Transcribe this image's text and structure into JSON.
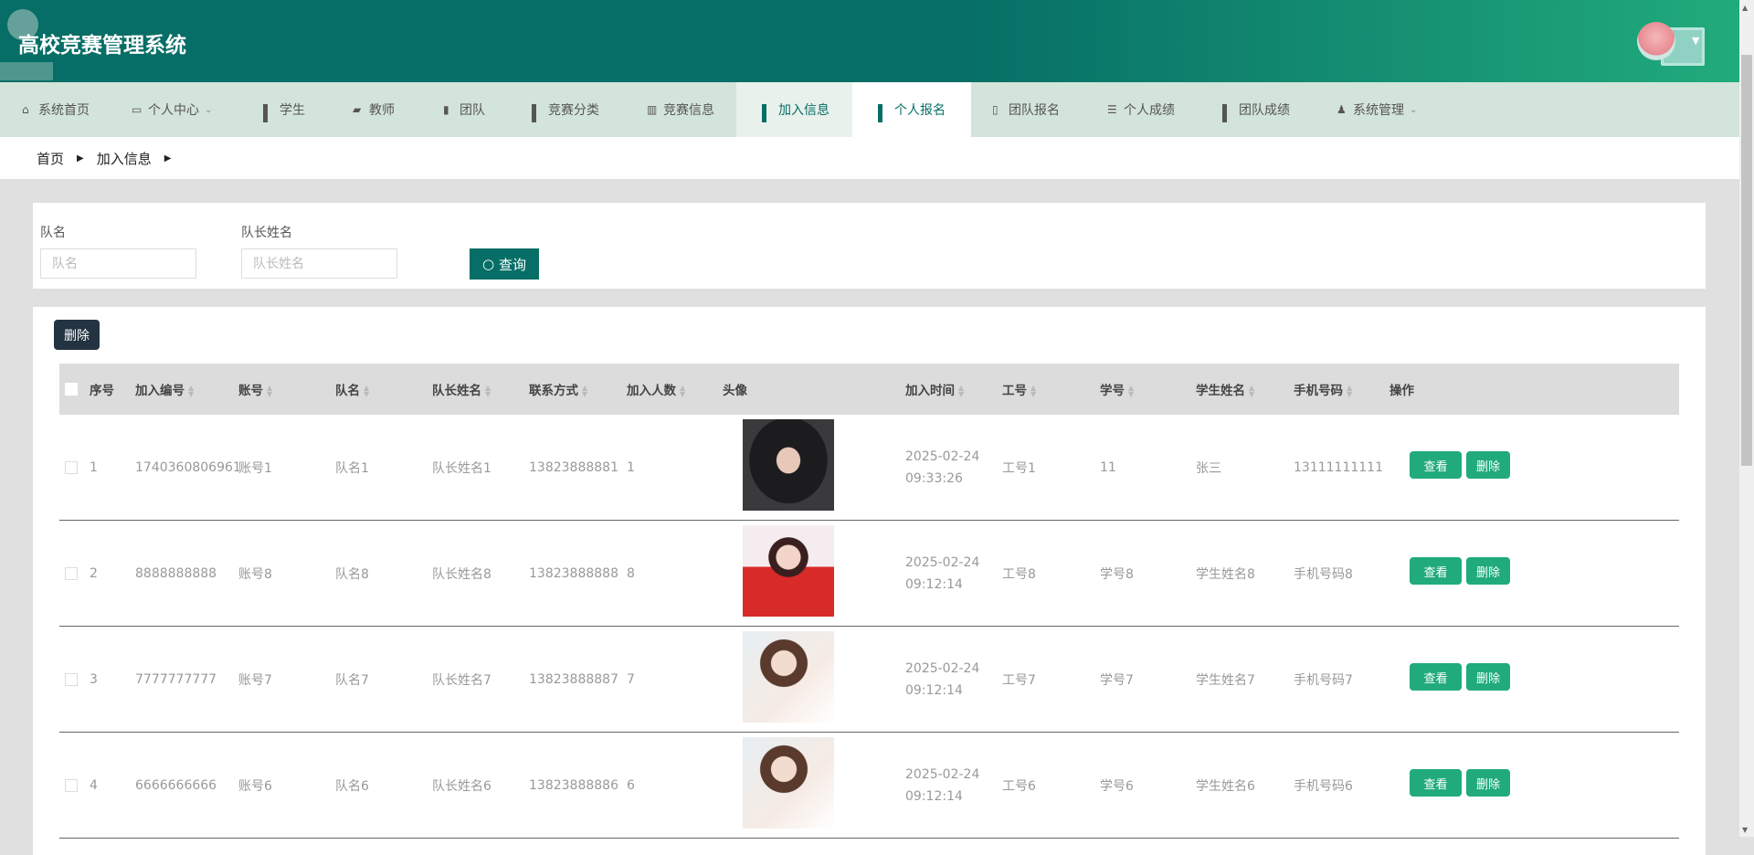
{
  "header": {
    "title": "高校竞赛管理系统"
  },
  "nav": [
    {
      "label": "系统首页",
      "icon": "home-icon"
    },
    {
      "label": "个人中心",
      "icon": "wallet-icon",
      "dropdown": true
    },
    {
      "label": "学生",
      "icon": "grid-icon"
    },
    {
      "label": "教师",
      "icon": "briefcase-icon"
    },
    {
      "label": "团队",
      "icon": "stamp-icon"
    },
    {
      "label": "竞赛分类",
      "icon": "grid-icon"
    },
    {
      "label": "竞赛信息",
      "icon": "book-icon"
    },
    {
      "label": "加入信息",
      "icon": "grid-icon"
    },
    {
      "label": "个人报名",
      "icon": "grid-icon"
    },
    {
      "label": "团队报名",
      "icon": "clipboard-icon"
    },
    {
      "label": "个人成绩",
      "icon": "list-icon"
    },
    {
      "label": "团队成绩",
      "icon": "grid-icon"
    },
    {
      "label": "系统管理",
      "icon": "user-icon",
      "dropdown": true
    }
  ],
  "breadcrumb": [
    "首页",
    "加入信息"
  ],
  "search": {
    "team_label": "队名",
    "team_placeholder": "队名",
    "leader_label": "队长姓名",
    "leader_placeholder": "队长姓名",
    "button": "查询"
  },
  "toolbar": {
    "delete": "删除"
  },
  "table": {
    "headers": [
      "序号",
      "加入编号",
      "账号",
      "队名",
      "队长姓名",
      "联系方式",
      "加入人数",
      "头像",
      "加入时间",
      "工号",
      "学号",
      "学生姓名",
      "手机号码",
      "操作"
    ],
    "view_label": "查看",
    "delete_label": "删除",
    "rows": [
      {
        "no": "1",
        "code": "1740360806961",
        "account": "账号1",
        "team": "队名1",
        "leader": "队长姓名1",
        "phone": "13823888881",
        "count": "1",
        "time": "2025-02-24 09:33:26",
        "staff": "工号1",
        "sid": "11",
        "sname": "张三",
        "mobile": "13111111111"
      },
      {
        "no": "2",
        "code": "8888888888",
        "account": "账号8",
        "team": "队名8",
        "leader": "队长姓名8",
        "phone": "13823888888",
        "count": "8",
        "time": "2025-02-24 09:12:14",
        "staff": "工号8",
        "sid": "学号8",
        "sname": "学生姓名8",
        "mobile": "手机号码8"
      },
      {
        "no": "3",
        "code": "7777777777",
        "account": "账号7",
        "team": "队名7",
        "leader": "队长姓名7",
        "phone": "13823888887",
        "count": "7",
        "time": "2025-02-24 09:12:14",
        "staff": "工号7",
        "sid": "学号7",
        "sname": "学生姓名7",
        "mobile": "手机号码7"
      },
      {
        "no": "4",
        "code": "6666666666",
        "account": "账号6",
        "team": "队名6",
        "leader": "队长姓名6",
        "phone": "13823888886",
        "count": "6",
        "time": "2025-02-24 09:12:14",
        "staff": "工号6",
        "sid": "学号6",
        "sname": "学生姓名6",
        "mobile": "手机号码6"
      }
    ]
  }
}
